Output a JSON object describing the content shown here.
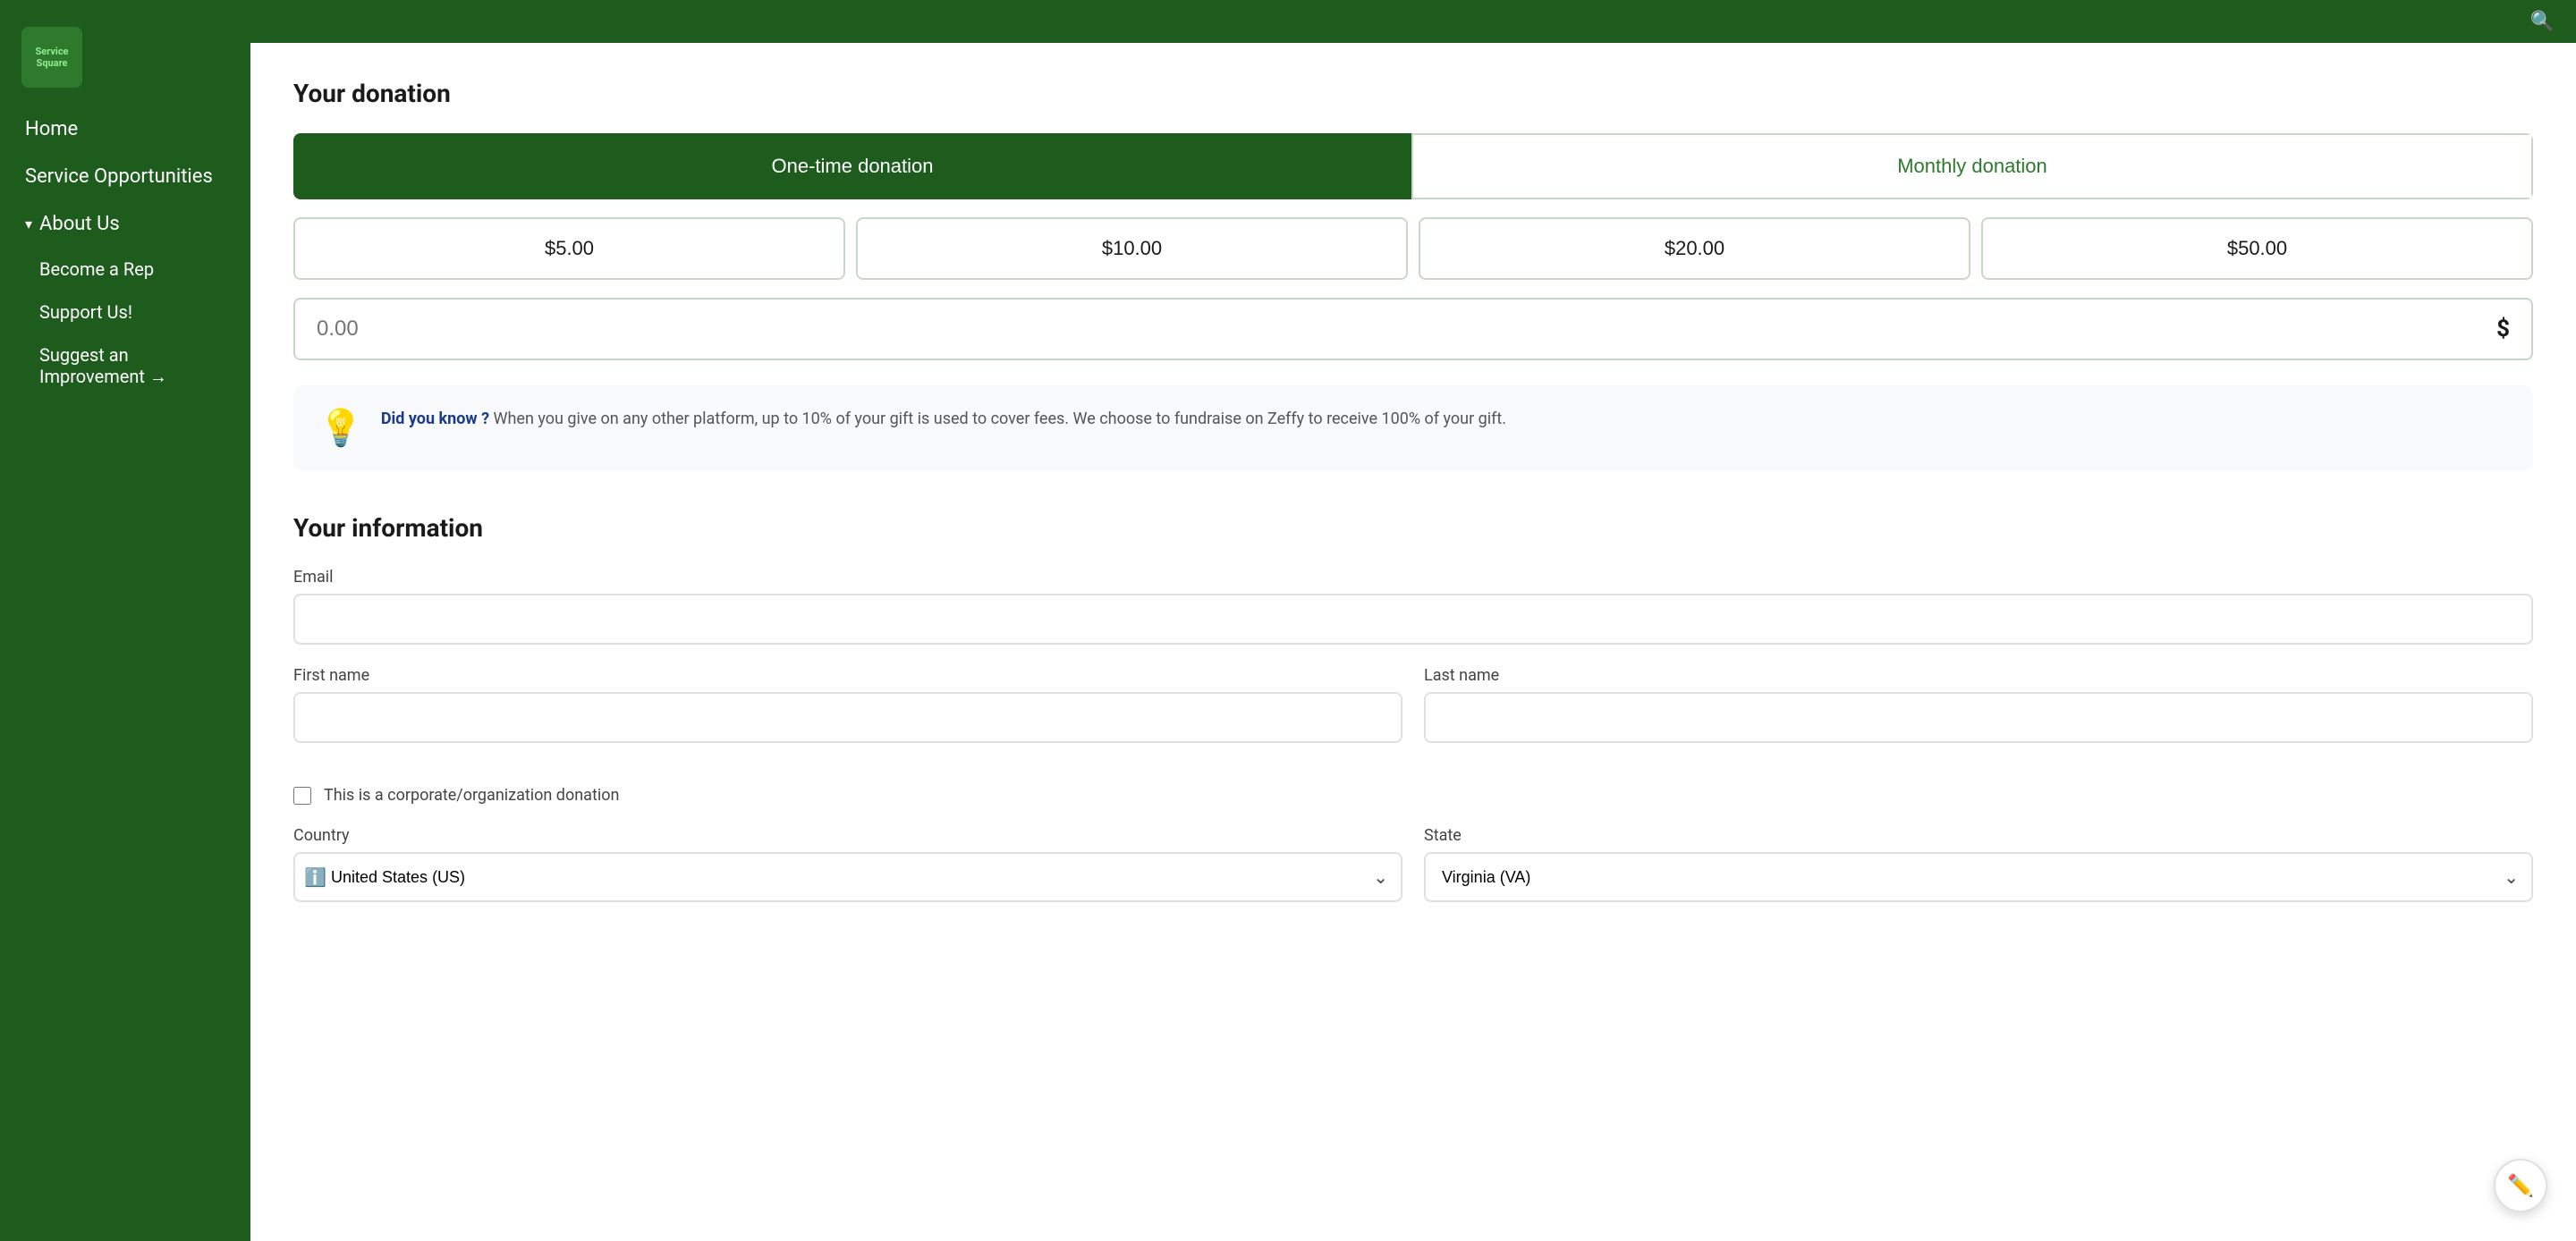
{
  "sidebar": {
    "logo_text": "Service\nSquare",
    "nav_items": [
      {
        "id": "home",
        "label": "Home",
        "active": false,
        "indent": false
      },
      {
        "id": "service-opportunities",
        "label": "Service Opportunities",
        "active": false,
        "indent": false
      },
      {
        "id": "about-us",
        "label": "About Us",
        "active": false,
        "indent": false,
        "has_chevron": true,
        "expanded": true
      },
      {
        "id": "become-a-rep",
        "label": "Become a Rep",
        "active": false,
        "indent": true
      },
      {
        "id": "support-us",
        "label": "Support Us!",
        "active": true,
        "indent": true
      },
      {
        "id": "suggest-improvement",
        "label": "Suggest an Improvement →",
        "active": false,
        "indent": true
      }
    ]
  },
  "topbar": {
    "search_icon": "🔍"
  },
  "donation": {
    "section_title": "Your donation",
    "type_one_time": "One-time donation",
    "type_monthly": "Monthly donation",
    "amounts": [
      "$5.00",
      "$10.00",
      "$20.00",
      "$50.00"
    ],
    "custom_placeholder": "0.00",
    "currency_symbol": "$",
    "info_bold": "Did you know ?",
    "info_text": " When you give on any other platform, up to 10% of your gift is used to cover fees. We choose to fundraise on Zeffy to receive 100% of your gift."
  },
  "your_information": {
    "section_title": "Your information",
    "email_label": "Email",
    "email_placeholder": "",
    "first_name_label": "First name",
    "first_name_placeholder": "",
    "last_name_label": "Last name",
    "last_name_placeholder": "",
    "corporate_label": "This is a corporate/organization donation",
    "country_label": "Country",
    "state_label": "State",
    "country_value": "United States (US)",
    "state_value": "Virginia (VA)"
  }
}
